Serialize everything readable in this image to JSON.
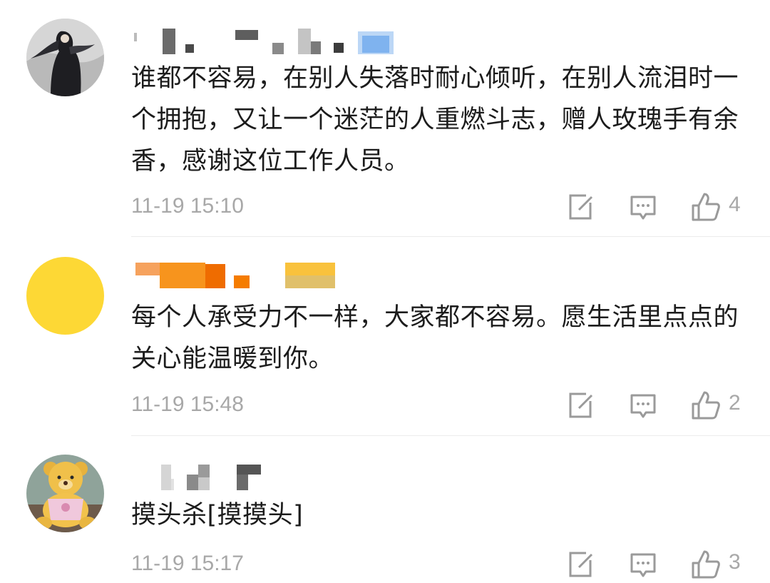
{
  "comments": [
    {
      "avatar": "figure-in-dark-cloak-avatar",
      "text": "谁都不容易，在别人失落时耐心倾听，在别人流泪时一个拥抱，又让一个迷茫的人重燃斗志，赠人玫瑰手有余香，感谢这位工作人员。",
      "time": "11-19 15:10",
      "likes": "4"
    },
    {
      "avatar": "yellow-circle-avatar",
      "text": "每个人承受力不一样，大家都不容易。愿生活里点点的关心能温暖到你。",
      "time": "11-19 15:48",
      "likes": "2"
    },
    {
      "avatar": "teddy-bear-avatar",
      "text": "摸头杀[摸摸头]",
      "time": "11-19 15:17",
      "likes": "3"
    }
  ],
  "colors": {
    "text": "#1c1c1c",
    "meta": "#a8a8a8",
    "divider": "#ececec",
    "yellow_avatar": "#fdd835",
    "username_orange": "#f57c00",
    "username_gold": "#f9a825"
  }
}
